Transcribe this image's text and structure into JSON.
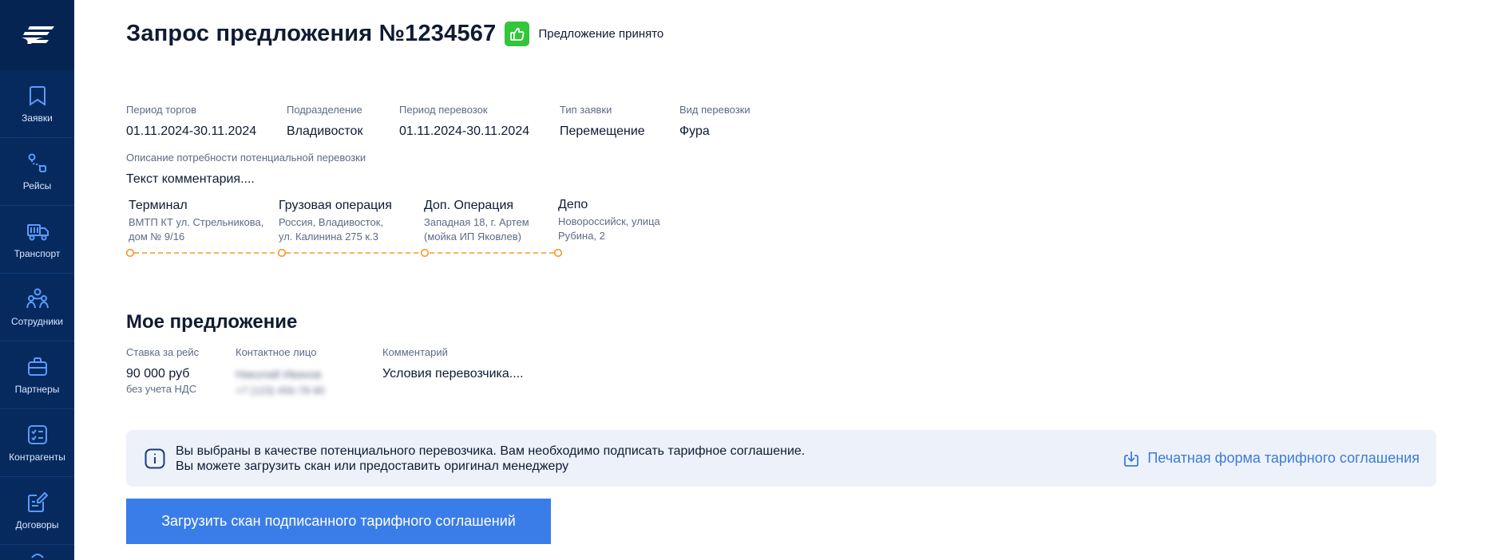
{
  "sidebar": {
    "items": [
      {
        "label": "Заявки",
        "icon": "bookmark-icon"
      },
      {
        "label": "Рейсы",
        "icon": "route-icon"
      },
      {
        "label": "Транспорт",
        "icon": "truck-icon"
      },
      {
        "label": "Сотрудники",
        "icon": "employees-icon"
      },
      {
        "label": "Партнеры",
        "icon": "briefcase-icon"
      },
      {
        "label": "Контрагенты",
        "icon": "checklist-icon"
      },
      {
        "label": "Договоры",
        "icon": "contract-edit-icon"
      }
    ]
  },
  "header": {
    "title": "Запрос предложения №1234567",
    "status": "Предложение принято",
    "status_color": "#33c53a"
  },
  "details": {
    "trade_period": {
      "label": "Период торгов",
      "value": "01.11.2024-30.11.2024"
    },
    "division": {
      "label": "Подразделение",
      "value": "Владивосток"
    },
    "transport_period": {
      "label": "Период перевозок",
      "value": "01.11.2024-30.11.2024"
    },
    "request_type": {
      "label": "Тип заявки",
      "value": "Перемещение"
    },
    "transport_kind": {
      "label": "Вид перевозки",
      "value": "Фура"
    },
    "description": {
      "label": "Описание потребности потенциальной перевозки",
      "value": "Текст комментария...."
    }
  },
  "route": {
    "line_color": "#f29a26",
    "points": [
      {
        "title": "Терминал",
        "address": "ВМТП КТ ул. Стрельникова,\nдом № 9/16"
      },
      {
        "title": "Грузовая операция",
        "address": "Россия, Владивосток,\nул. Калинина 275 к.3"
      },
      {
        "title": "Доп. Операция",
        "address": "Западная 18, г. Артем\n(мойка ИП Яковлев)"
      },
      {
        "title": "Депо",
        "address": "Новороссийск, улица\nРубина, 2"
      }
    ]
  },
  "offer": {
    "title": "Мое предложение",
    "rate": {
      "label": "Ставка за рейс",
      "value": "90 000 руб",
      "note": "без учета НДС"
    },
    "contact": {
      "label": "Контактное лицо",
      "name": "Николай Иванов",
      "phone": "+7 (123) 456-78-90"
    },
    "comment": {
      "label": "Комментарий",
      "value": "Условия перевозчика...."
    }
  },
  "info_banner": {
    "line1": "Вы выбраны в качестве потенциального перевозчика. Вам необходимо подписать тарифное соглашение.",
    "line2": "Вы можете загрузить скан или предоставить оригинал менеджеру",
    "link": "Печатная форма тарифного соглашения"
  },
  "upload_button": "Загрузить скан подписанного тарифного соглашений",
  "colors": {
    "sidebar": "#062a5e",
    "accent": "#3a7de8",
    "link": "#3d7bd6",
    "route": "#f29a26"
  }
}
